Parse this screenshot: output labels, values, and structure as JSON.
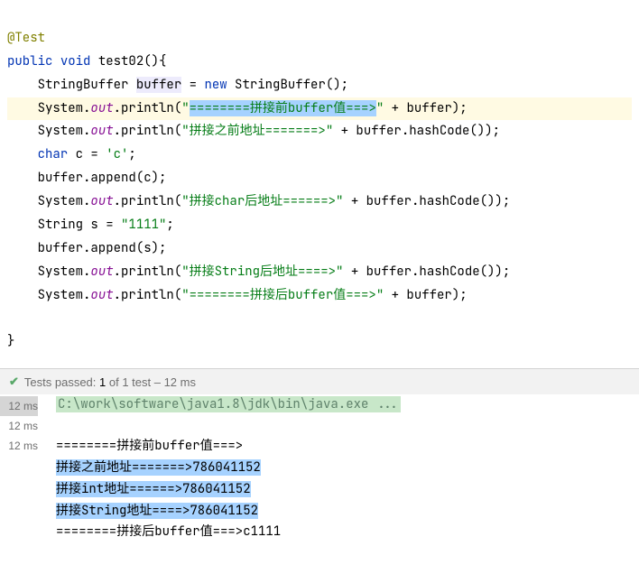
{
  "code": {
    "annotation": "@Test",
    "kw_public": "public",
    "kw_void": "void",
    "method_name": "test02",
    "line2_sig_tail": "(){",
    "line3": {
      "type1": "StringBuffer",
      "var": "buffer",
      "eq": " = ",
      "kw_new": "new",
      "type2": " StringBuffer();"
    },
    "line4": {
      "prefix": "System.",
      "out": "out",
      "call": ".println(",
      "str_q": "\"",
      "str_hl": "========拼接前buffer值===>",
      "tail": " + buffer);"
    },
    "line5": {
      "prefix": "System.",
      "out": "out",
      "call": ".println(",
      "str": "\"拼接之前地址=======>\"",
      "tail": " + buffer.hashCode());"
    },
    "line6": {
      "kw_char": "char",
      "rest": " c = ",
      "lit": "'c'",
      "semi": ";"
    },
    "line7": "buffer.append(c);",
    "line8": {
      "prefix": "System.",
      "out": "out",
      "call": ".println(",
      "str": "\"拼接char后地址======>\"",
      "tail": " + buffer.hashCode());"
    },
    "line9": {
      "type": "String s = ",
      "str": "\"1111\"",
      "semi": ";"
    },
    "line10": "buffer.append(s);",
    "line11": {
      "prefix": "System.",
      "out": "out",
      "call": ".println(",
      "str": "\"拼接String后地址====>\"",
      "tail": " + buffer.hashCode());"
    },
    "line12": {
      "prefix": "System.",
      "out": "out",
      "call": ".println(",
      "str": "\"========拼接后buffer值===>\"",
      "tail": " + buffer);"
    },
    "close_brace": "}"
  },
  "results": {
    "passed_label": "Tests passed:",
    "passed_count": "1",
    "of_text": " of 1 test – 12 ms",
    "times": [
      "12 ms",
      "12 ms",
      "12 ms"
    ],
    "cmd": "C:\\work\\software\\java1.8\\jdk\\bin\\java.exe ...",
    "out1": "========拼接前buffer值===>",
    "out2": "拼接之前地址=======>786041152",
    "out3": "拼接int地址======>786041152",
    "out4": "拼接String地址====>786041152",
    "out5": "========拼接后buffer值===>c1111"
  }
}
